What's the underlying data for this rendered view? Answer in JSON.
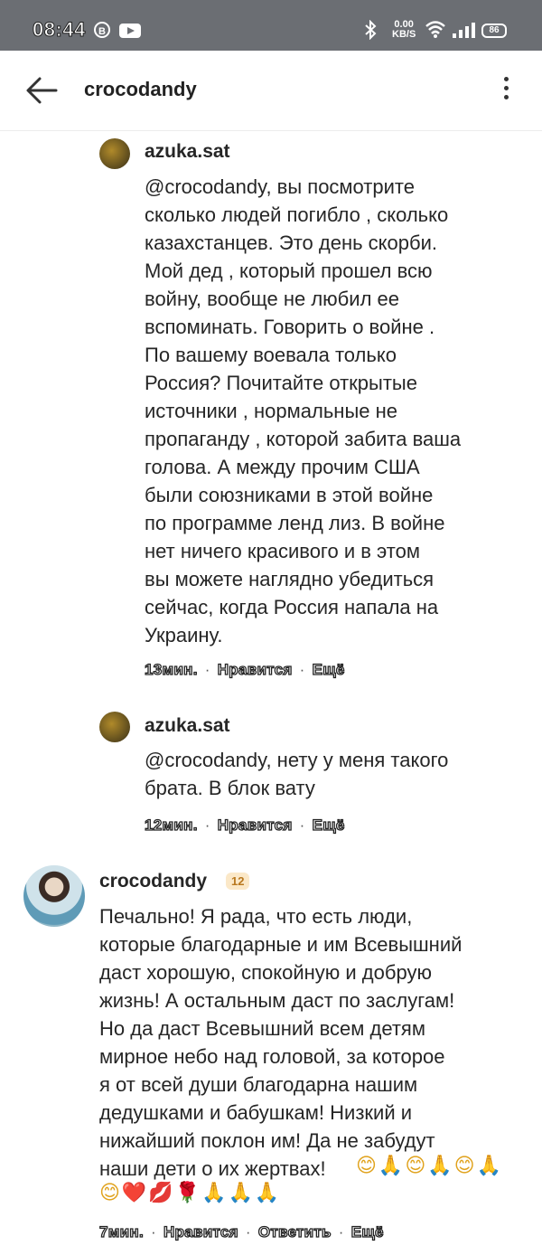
{
  "status_bar": {
    "time": "08:44",
    "b_icon": "B",
    "net_speed_top": "0.00",
    "net_speed_bottom": "KB/S",
    "battery": "86"
  },
  "header": {
    "title": "crocodandy"
  },
  "comments": [
    {
      "user": "azuka.sat",
      "text": "@crocodandy, вы посмотрите\nсколько людей погибло , сколько\nказахстанцев. Это день скорби.\nМой дед , который прошел всю\nвойну, вообще не любил ее\nвспоминать. Говорить о войне .\nПо вашему воевала только\nРоссия?  Почитайте открытые\nисточники , нормальные не\nпропаганду , которой забита ваша\nголова. А между прочим США\nбыли союзниками в этой войне\nпо программе ленд лиз. В войне\nнет ничего красивого и в этом\nвы можете наглядно убедиться\nсейчас, когда Россия напала на\nУкраину.",
      "time": "13мин.",
      "like": "Нравится",
      "more": "Ещё"
    },
    {
      "user": "azuka.sat",
      "text": "@crocodandy, нету у меня такого\nбрата. В блок вату",
      "time": "12мин.",
      "like": "Нравится",
      "more": "Ещё"
    },
    {
      "user": "crocodandy",
      "badge": "12",
      "text": "Печально! Я рада, что есть люди,\nкоторые благодарные и им Всевышний\nдаст хорошую, спокойную и добрую\nжизнь! А остальным даст по заслугам!\nНо да даст Всевышний всем детям\nмирное небо над головой, за которое\nя от всей души благодарна нашим\nдедушками и бабушкам! Низкий и\nнижайший поклон им! Да не забудут\nнаши дети о их жертвах!",
      "emoji_line1": "😊🙏😊🙏😊🙏",
      "emoji_line2": "😊❤️💋🌹🙏🙏🙏",
      "time": "7мин.",
      "like": "Нравится",
      "reply": "Ответить",
      "more": "Ещё"
    }
  ],
  "icons": {
    "back": "arrow-left-icon",
    "more": "vertical-dots-icon",
    "bluetooth": "bluetooth-icon",
    "wifi": "wifi-icon",
    "signal": "signal-icon",
    "battery": "battery-icon",
    "youtube": "youtube-icon"
  }
}
